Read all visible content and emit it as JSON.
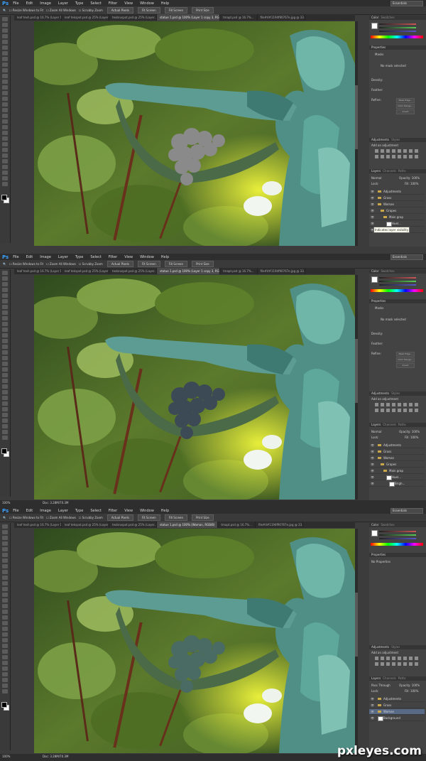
{
  "menu": [
    "File",
    "Edit",
    "Image",
    "Layer",
    "Type",
    "Select",
    "Filter",
    "View",
    "Window",
    "Help"
  ],
  "app_logo": "Ps",
  "options": {
    "resize": "Resize Windows to Fit",
    "zoom_all": "Zoom All Windows",
    "scrubby": "Scrubby Zoom",
    "buttons": [
      "Actual Pixels",
      "Fit Screen",
      "Fill Screen",
      "Print Size"
    ]
  },
  "workspace": "Essentials",
  "panels": [
    {
      "tabs": [
        "leaf texh.psd @ 16.7% (Layer 1...",
        "leaf tekspot.psd @ 25% (Layer 1, RGB/8)",
        "texbruspot.psd @ 25% (Layer...",
        "statue 1.psd @ 100% (Layer 1 copy 3, RGB/8)",
        "tmapt.psd @ 16.7%...",
        "file#4#1194f90767e.jpg @ 33.3% (RGB...)"
      ],
      "active_tab": 3,
      "properties_title": "Properties",
      "masks_label": "Masks",
      "no_mask": "No mask selected",
      "density": "Density:",
      "feather": "Feather:",
      "refine": "Refine:",
      "refine_buttons": [
        "Mask Edge...",
        "Color Range...",
        "Invert"
      ],
      "adj_tabs": [
        "Adjustments",
        "Styles"
      ],
      "adj_title": "Add an adjustment",
      "layer_tabs": [
        "Layers",
        "Channels",
        "Paths"
      ],
      "blend": "Normal",
      "opacity_label": "Opacity:",
      "opacity": "100%",
      "lock_label": "Lock:",
      "fill_label": "Fill:",
      "fill": "100%",
      "layers": [
        {
          "name": "Adjustments",
          "type": "group"
        },
        {
          "name": "Grass",
          "type": "group"
        },
        {
          "name": "Woman",
          "type": "group"
        },
        {
          "name": "Grapes",
          "type": "group"
        },
        {
          "name": "Main grap",
          "type": "group"
        },
        {
          "name": "Huel...",
          "type": "adj"
        },
        {
          "name": "Brigh...",
          "type": "adj"
        }
      ],
      "tooltip": "Indicates layer visibility",
      "zoom": "",
      "doc": ""
    },
    {
      "tabs": [
        "leaf texh.psd @ 16.7% (Layer 1...",
        "leaf tekspot.psd @ 25% (Layer 1, RGB/8)",
        "texbruspot.psd @ 25% (Layer...",
        "statue 1.psd @ 100% (Layer 1 copy 3, RGB/8)",
        "tmapt.psd @ 16.7%...",
        "file#4#1194f90767e.jpg @ 33.3% (RGB...)"
      ],
      "active_tab": 3,
      "properties_title": "Properties",
      "masks_label": "Masks",
      "no_mask": "No mask selected",
      "density": "Density:",
      "feather": "Feather:",
      "refine": "Refine:",
      "refine_buttons": [
        "Mask Edge...",
        "Color Range...",
        "Invert"
      ],
      "adj_tabs": [
        "Adjustments",
        "Styles"
      ],
      "adj_title": "Add an adjustment",
      "layer_tabs": [
        "Layers",
        "Channels",
        "Paths"
      ],
      "blend": "Normal",
      "opacity_label": "Opacity:",
      "opacity": "100%",
      "lock_label": "Lock:",
      "fill_label": "Fill:",
      "fill": "100%",
      "layers": [
        {
          "name": "Adjustments",
          "type": "group"
        },
        {
          "name": "Grass",
          "type": "group"
        },
        {
          "name": "Woman",
          "type": "group"
        },
        {
          "name": "Grapes",
          "type": "group"
        },
        {
          "name": "Main grap",
          "type": "group"
        },
        {
          "name": "Huel...",
          "type": "adj"
        },
        {
          "name": "Brigh...",
          "type": "adj"
        }
      ],
      "tooltip": "",
      "zoom": "100%",
      "doc": "Doc: 3.28M/70.3M"
    },
    {
      "tabs": [
        "leaf texh.psd @ 16.7% (Layer 1...",
        "leaf tekspot.psd @ 25% (Layer 1, RGB/8)",
        "texbruspot.psd @ 25% (Layer...",
        "statue 1.psd @ 100% (Woman, RGB/8)",
        "tmapt.psd @ 16.7%...",
        "file#4#1194f90767e.jpg @ 33.3% (RGB...)"
      ],
      "active_tab": 3,
      "properties_title": "Properties",
      "masks_label": "",
      "no_mask": "No Properties",
      "density": "",
      "feather": "",
      "refine": "",
      "refine_buttons": [],
      "adj_tabs": [
        "Adjustments",
        "Styles"
      ],
      "adj_title": "Add an adjustment",
      "layer_tabs": [
        "Layers",
        "Channels",
        "Paths"
      ],
      "blend": "Pass Through",
      "opacity_label": "Opacity:",
      "opacity": "100%",
      "lock_label": "Lock:",
      "fill_label": "Fill:",
      "fill": "100%",
      "layers": [
        {
          "name": "Adjustments",
          "type": "group"
        },
        {
          "name": "Grass",
          "type": "group"
        },
        {
          "name": "Woman",
          "type": "group",
          "selected": true
        },
        {
          "name": "Background",
          "type": "layer"
        }
      ],
      "tooltip": "",
      "zoom": "100%",
      "doc": "Doc: 3.28M/70.3M"
    }
  ],
  "watermark": "pxleyes.com",
  "colors": {
    "grape_tint": [
      "#8a8a8a",
      "#3c4a55",
      "#4a6a64"
    ]
  }
}
